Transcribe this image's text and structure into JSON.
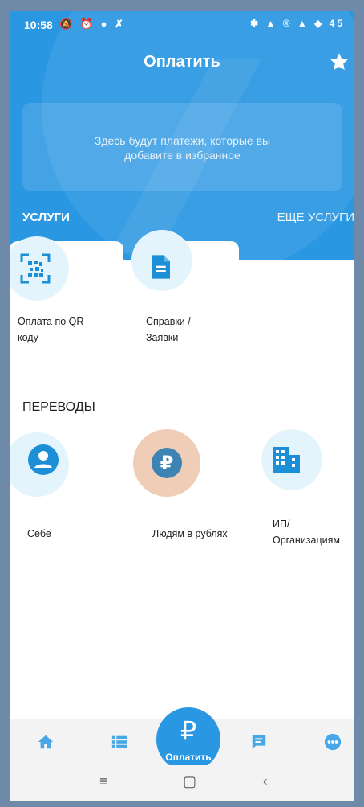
{
  "status_bar": {
    "time": "10:58",
    "left_icons": "🔕 ⏰ ● ✗",
    "right_icons": "✱ ▲ ® ▲ ◆ 45"
  },
  "header": {
    "title": "Оплатить"
  },
  "favorites": {
    "empty_text": "Здесь будут платежи, которые вы добавите в избранное"
  },
  "services": {
    "heading": "УСЛУГИ",
    "more": "ЕЩЕ УСЛУГИ",
    "items": [
      {
        "label": "Оплата по QR-кода",
        "line1": "Оплата по QR-",
        "line2": "коду",
        "icon": "qr-code-icon"
      },
      {
        "label": "Справки / Заявки",
        "line1": "Справки /",
        "line2": "Заявки",
        "icon": "document-icon"
      }
    ]
  },
  "transfers": {
    "heading": "ПЕРЕВОДЫ",
    "items": [
      {
        "line1": "Себе",
        "icon": "person-icon"
      },
      {
        "line1": "Людям в рублях",
        "icon": "ruble-icon"
      },
      {
        "line1": "ИП/",
        "line2": "Организациям",
        "icon": "building-icon"
      }
    ]
  },
  "tabbar": {
    "pay_label": "Оплатить",
    "pay_symbol": "₽",
    "tabs": [
      "home-icon",
      "list-icon",
      "chat-icon",
      "more-icon"
    ]
  },
  "colors": {
    "accent": "#2a97e2",
    "icon_blue": "#1d8fd6",
    "highlight": "#f0cdb6"
  }
}
